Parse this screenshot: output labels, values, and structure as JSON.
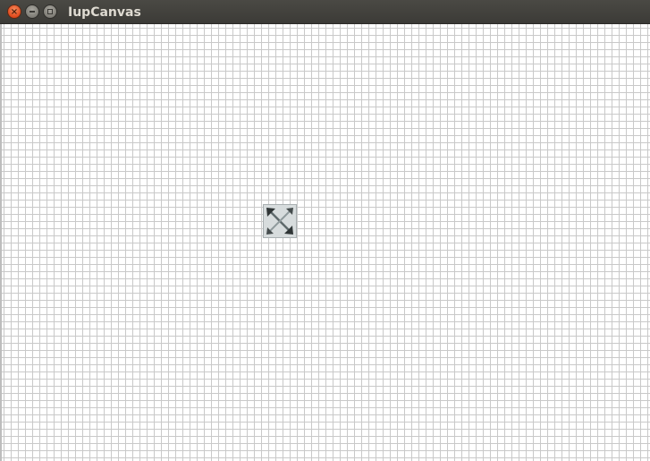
{
  "window": {
    "title": "IupCanvas",
    "close_glyph": "×",
    "close_icon": "close-icon",
    "minimize_icon": "minimize-icon",
    "maximize_icon": "maximize-icon"
  },
  "canvas": {
    "grid_color": "#c9c9c9",
    "background_color": "#ffffff",
    "center_icon": "resize-arrows-icon"
  }
}
